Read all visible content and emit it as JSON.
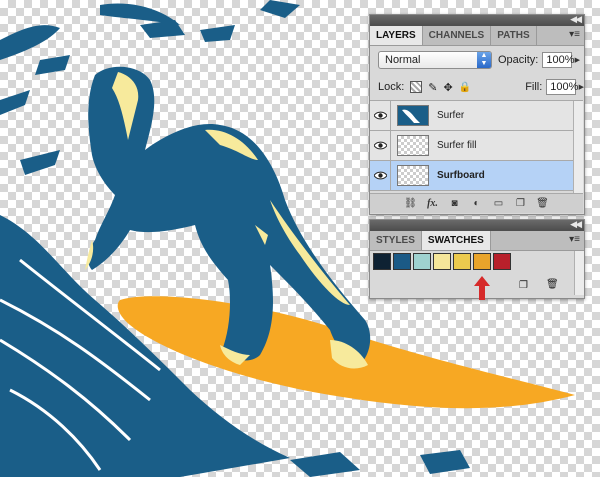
{
  "layers_panel": {
    "collapse_icon": "double-arrow-left-icon",
    "tabs": [
      "LAYERS",
      "CHANNELS",
      "PATHS"
    ],
    "blend_mode": "Normal",
    "opacity_label": "Opacity:",
    "opacity_value": "100%",
    "lock_label": "Lock:",
    "fill_label": "Fill:",
    "fill_value": "100%",
    "layers": [
      {
        "name": "Surfer",
        "thumb": "surfer"
      },
      {
        "name": "Surfer fill",
        "thumb": "transparent"
      },
      {
        "name": "Surfboard",
        "thumb": "transparent",
        "selected": true
      }
    ],
    "toolbar_icons": [
      "link-icon",
      "fx-icon",
      "mask-icon",
      "adjustment-icon",
      "folder-icon",
      "new-layer-icon",
      "trash-icon"
    ],
    "fx_label": "fx."
  },
  "swatches_panel": {
    "tabs": [
      "STYLES",
      "SWATCHES"
    ],
    "swatches": [
      "#0e2233",
      "#1b5a86",
      "#9fd1cf",
      "#f5e69a",
      "#ecca4e",
      "#e8a42b",
      "#b8202b"
    ],
    "pointer_color": "#d62a2a"
  },
  "artwork": {
    "wave_color": "#1a5e88",
    "highlight_color": "#f7ea9c",
    "board_color": "#f7a823"
  }
}
